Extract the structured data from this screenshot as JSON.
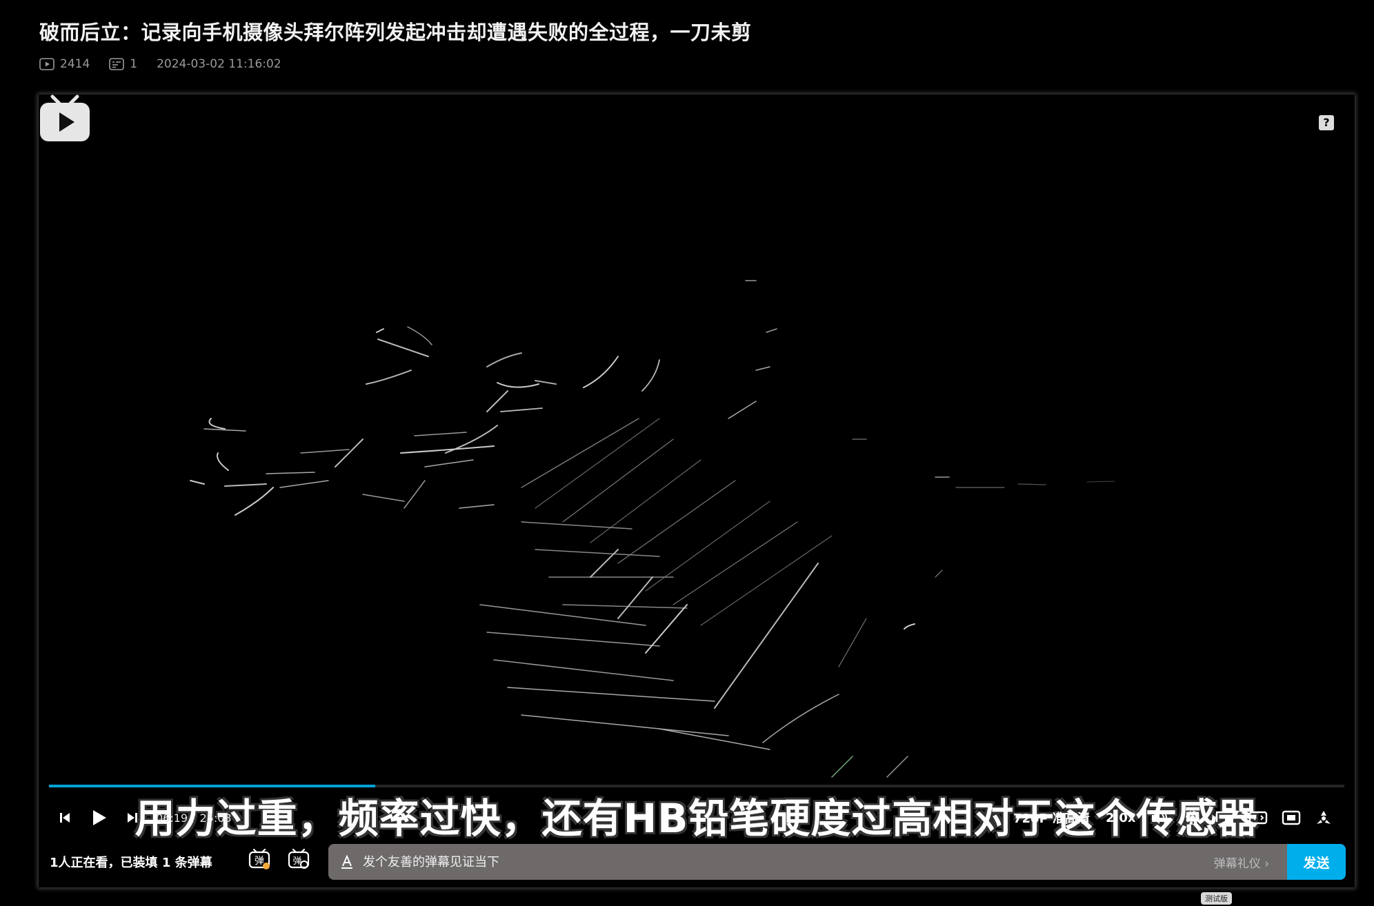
{
  "title": "破而后立：记录向手机摄像头拜尔阵列发起冲击却遭遇失败的全过程，一刀未剪",
  "meta": {
    "play_count": "2414",
    "danmaku_count": "1",
    "date": "2024-03-02 11:16:02",
    "play_icon": "play-count-icon",
    "danmaku_icon": "danmaku-count-icon"
  },
  "player": {
    "subtitle": "用力过重，频率过快，还有HB铅笔硬度过高相对于这个传感器",
    "current_time": "06:19",
    "time_separator": "/",
    "duration": "25:08",
    "progress": 0.252,
    "quality": "720P 准高清",
    "speed": "2.0x",
    "accent_color": "#00a1d6",
    "icons": [
      "prev-icon",
      "play-icon",
      "next-icon",
      "volume-icon",
      "settings-icon",
      "pip-icon",
      "widescreen-icon",
      "webfullscreen-icon",
      "fullscreen-icon",
      "help-icon",
      "bilibili-tv-logo"
    ]
  },
  "danmaku_bar": {
    "viewers_count": "1",
    "viewers_text": "人正在看，已装填",
    "loaded_count": "1",
    "loaded_unit": "条弹幕",
    "input_placeholder": "发个友善的弹幕见证当下",
    "etiquette_label": "弹幕礼仪 ›",
    "send_label": "发送",
    "send_color": "#00aeec"
  },
  "beta_tag": "测试版"
}
